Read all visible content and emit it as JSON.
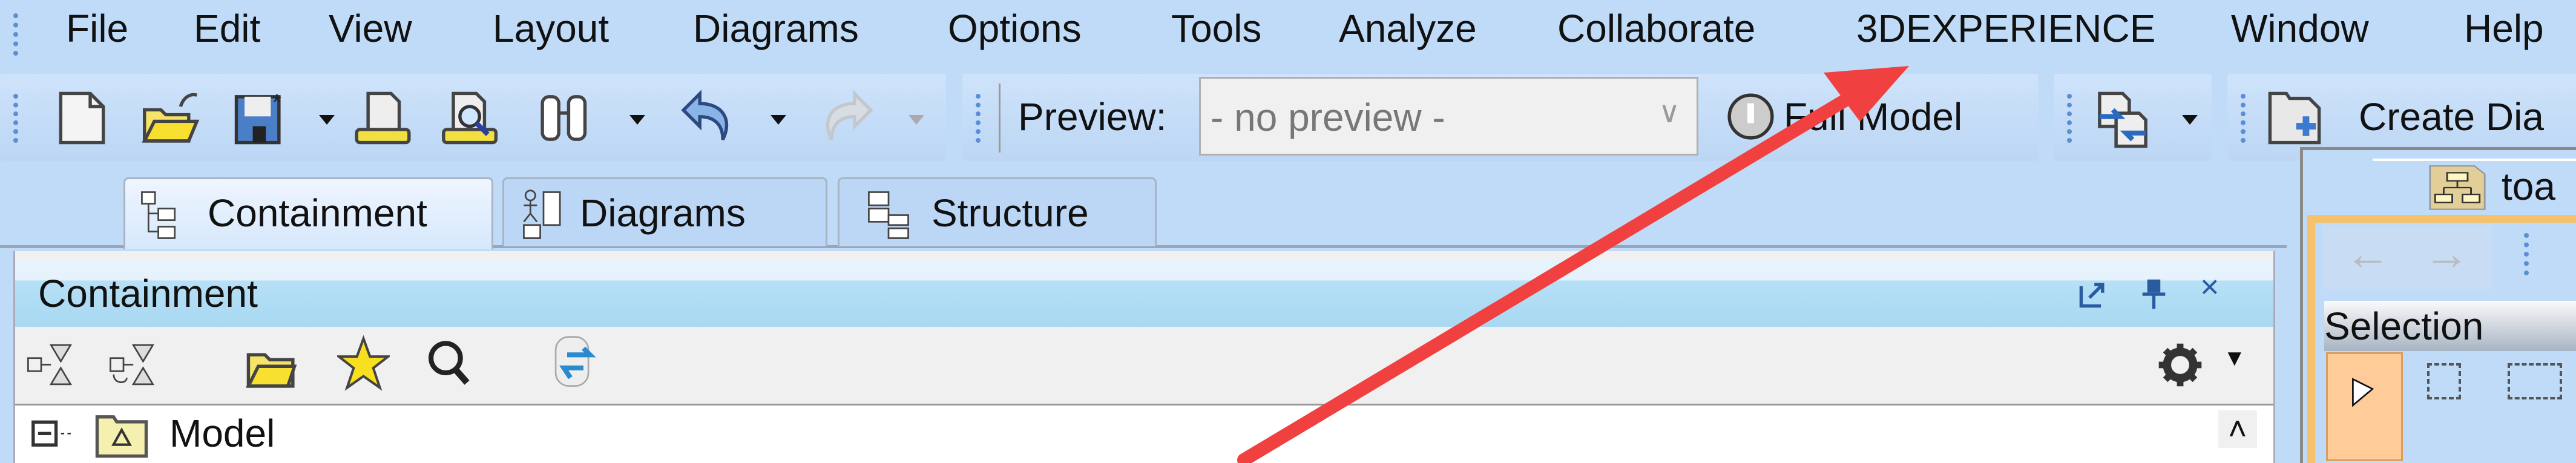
{
  "menu": [
    "File",
    "Edit",
    "View",
    "Layout",
    "Diagrams",
    "Options",
    "Tools",
    "Analyze",
    "Collaborate",
    "3DEXPERIENCE",
    "Window",
    "Help"
  ],
  "toolbar": {
    "icons": [
      "new-project-icon",
      "open-project-icon",
      "save-project-icon",
      "print-icon",
      "print-preview-icon",
      "find-icon",
      "undo-icon",
      "redo-icon"
    ],
    "preview_label": "Preview:",
    "preview_value": "- no preview -",
    "full_model_label": "Full Model",
    "create_diagram_label": "Create Dia"
  },
  "browser_tabs": [
    {
      "label": "Containment",
      "active": true
    },
    {
      "label": "Diagrams",
      "active": false
    },
    {
      "label": "Structure",
      "active": false
    }
  ],
  "containment": {
    "title": "Containment",
    "tree": [
      {
        "label": "Model",
        "expanded": true
      }
    ]
  },
  "diagram": {
    "tab_label": "toa",
    "palette_group": "Selection"
  },
  "colors": {
    "annotation_arrow": "#f04040",
    "diagram_frame": "#f5c26b",
    "selected_tool": "#ffcc99"
  }
}
